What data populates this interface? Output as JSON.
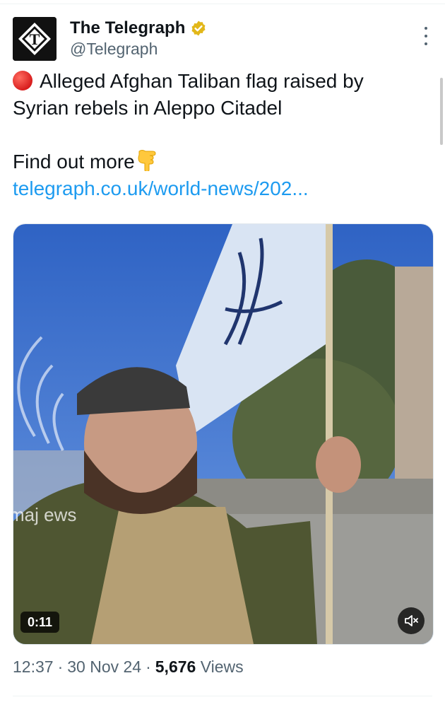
{
  "author": {
    "display_name": "The Telegraph",
    "handle": "@Telegraph",
    "avatar_icon": "telegraph-t-logo",
    "verified_color": "#e2b719"
  },
  "tweet": {
    "line1": "Alleged Afghan Taliban flag raised by",
    "line2": "Syrian rebels in Aleppo Citadel",
    "line3": "Find out more",
    "link": "telegraph.co.uk/world-news/202...",
    "emoji_1": "red-circle",
    "emoji_2": "backhand-index-pointing-down"
  },
  "media": {
    "duration": "0:11",
    "watermark": "maj ews",
    "mute_icon": "speaker-muted-icon"
  },
  "meta": {
    "time": "12:37",
    "date": "30 Nov 24",
    "separator": "·",
    "views_count": "5,676",
    "views_label": "Views"
  },
  "colors": {
    "link": "#1d9bf0",
    "secondary_text": "#536471",
    "primary_text": "#0f1419"
  }
}
